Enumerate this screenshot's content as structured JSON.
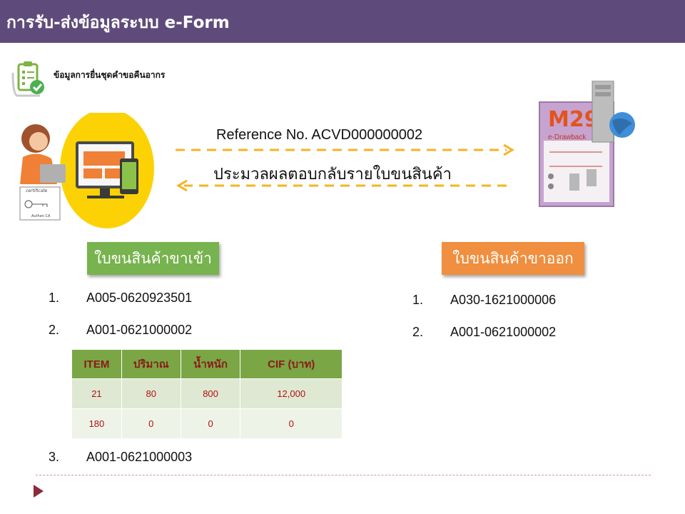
{
  "header": {
    "title": "การรับ-ส่งข้อมูลระบบ e-Form"
  },
  "doc": {
    "label": "ข้อมูลการยื่นชุดคำขอคืนอากร"
  },
  "client": {
    "certificate_label": "certificate",
    "ca_label": "Authen  CA"
  },
  "flow": {
    "reference": "Reference No. ACVD000000002",
    "response": "ประมวลผลตอบกลับรายใบขนสินค้า",
    "arrow_color": "#f5b325"
  },
  "server": {
    "logo": "M29",
    "label": "e-Drawback"
  },
  "import_section": {
    "title": "ใบขนสินค้าขาเข้า",
    "items": [
      {
        "num": "1.",
        "code": "A005-0620923501"
      },
      {
        "num": "2.",
        "code": "A001-0621000002"
      },
      {
        "num": "3.",
        "code": "A001-0621000003"
      }
    ],
    "table": {
      "headers": [
        "ITEM",
        "ปริมาณ",
        "น้ำหนัก",
        "CIF (บาท)"
      ],
      "rows": [
        [
          "21",
          "80",
          "800",
          "12,000"
        ],
        [
          "180",
          "0",
          "0",
          "0"
        ]
      ]
    }
  },
  "export_section": {
    "title": "ใบขนสินค้าขาออก",
    "items": [
      {
        "num": "1.",
        "code": "A030-1621000006"
      },
      {
        "num": "2.",
        "code": "A001-0621000002"
      }
    ]
  },
  "colors": {
    "header": "#5f4b7b",
    "import_button": "#77b34e",
    "export_button": "#ef8f3f",
    "table_header": "#7aa645",
    "table_text": "#b01212"
  }
}
